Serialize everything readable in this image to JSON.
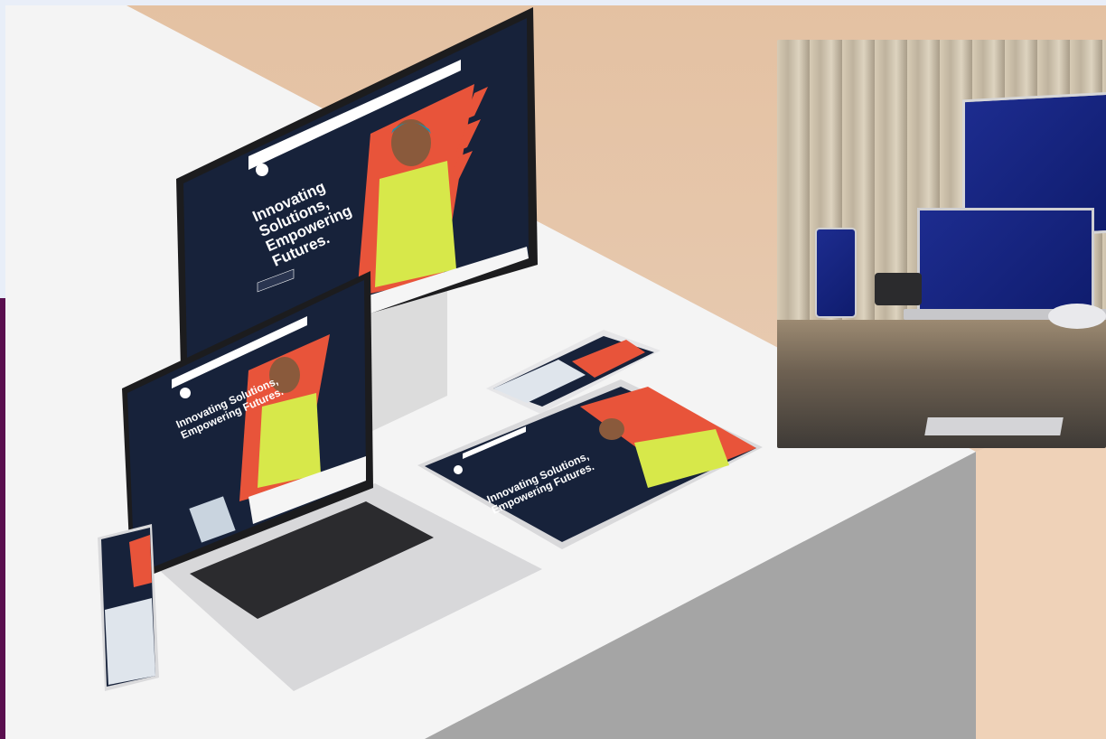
{
  "hero": {
    "headline_monitor": "Innovating Solutions,\nEmpowering Futures.",
    "headline_laptop": "Innovating Solutions,\nEmpowering Futures.",
    "headline_tablet": "Innovating Solutions,\nEmpowering Futures."
  },
  "colors": {
    "accent_orange": "#e8543a",
    "screen_navy": "#17223a",
    "blue_brand": "#1b2b8f",
    "purple_edge": "#5a0f4f"
  },
  "icons": {
    "logo": "brand-logo-icon",
    "worker": "worker-photo"
  }
}
